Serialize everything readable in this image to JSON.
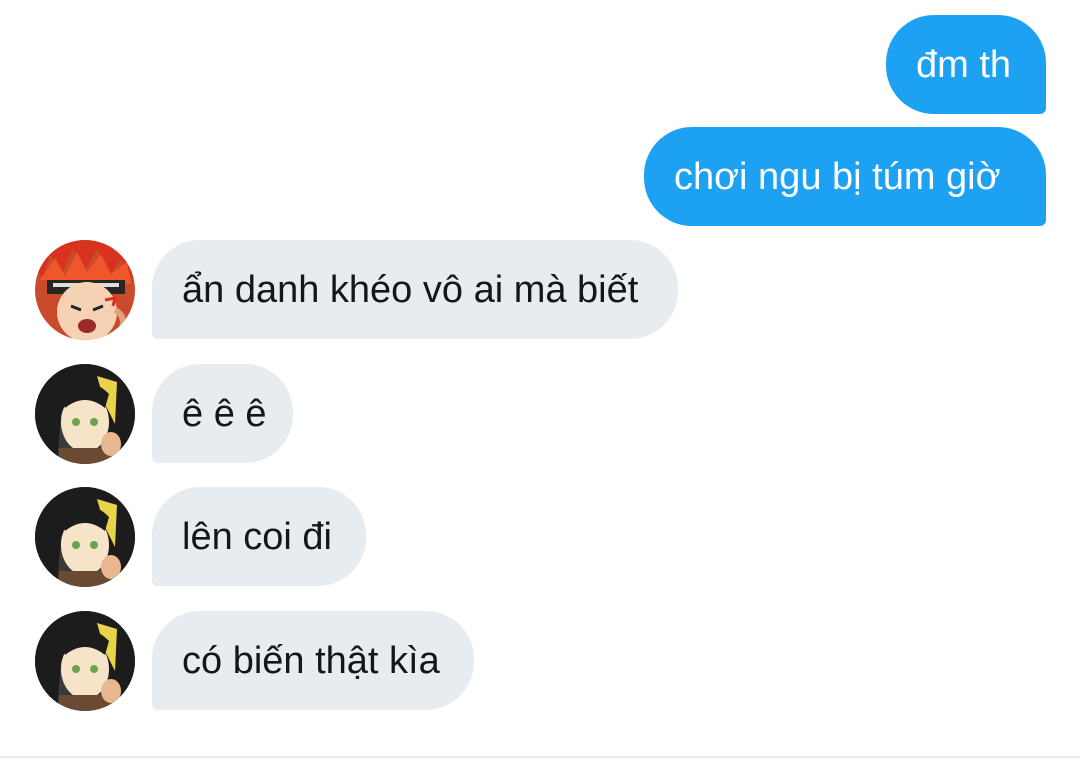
{
  "messages": [
    {
      "direction": "outgoing",
      "text": "đm th"
    },
    {
      "direction": "outgoing",
      "text": "chơi ngu bị túm giờ"
    },
    {
      "direction": "incoming",
      "avatar": "red-hair-headband-avatar",
      "text": "ẩn danh khéo vô ai mà biết"
    },
    {
      "direction": "incoming",
      "avatar": "black-yellow-hair-avatar",
      "text": "ê ê ê"
    },
    {
      "direction": "incoming",
      "avatar": "black-yellow-hair-avatar",
      "text": "lên coi đi"
    },
    {
      "direction": "incoming",
      "avatar": "black-yellow-hair-avatar",
      "text": "có biến thật kìa"
    }
  ],
  "colors": {
    "outgoing_bubble": "#1da1f2",
    "incoming_bubble": "#e6ecf0",
    "outgoing_text": "#ffffff",
    "incoming_text": "#14171a"
  }
}
